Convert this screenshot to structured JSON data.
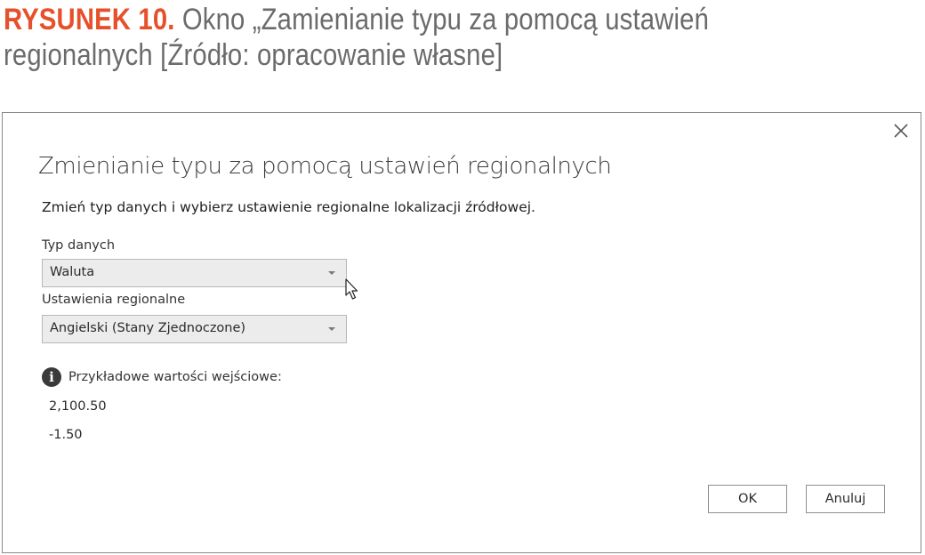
{
  "caption": {
    "prefix": "RYSUNEK 10.",
    "text": " Okno „Zamienianie typu za pomocą ustawień regionalnych [Źródło: opracowanie własne]"
  },
  "dialog": {
    "title": "Zmienianie typu za pomocą ustawień regionalnych",
    "description": "Zmień typ danych i wybierz ustawienie regionalne lokalizacji źródłowej.",
    "close_icon": "close-icon",
    "data_type": {
      "label": "Typ danych",
      "value": "Waluta"
    },
    "locale": {
      "label": "Ustawienia regionalne",
      "value": "Angielski (Stany Zjednoczone)"
    },
    "samples": {
      "icon": "info-icon",
      "label": "Przykładowe wartości wejściowe:",
      "values": [
        "2,100.50",
        "-1.50"
      ]
    },
    "buttons": {
      "ok": "OK",
      "cancel": "Anuluj"
    }
  },
  "colors": {
    "caption_accent": "#e6502a",
    "caption_text": "#6b6b6b",
    "dropdown_bg": "#ececec",
    "dialog_border": "#8a8a8a"
  }
}
